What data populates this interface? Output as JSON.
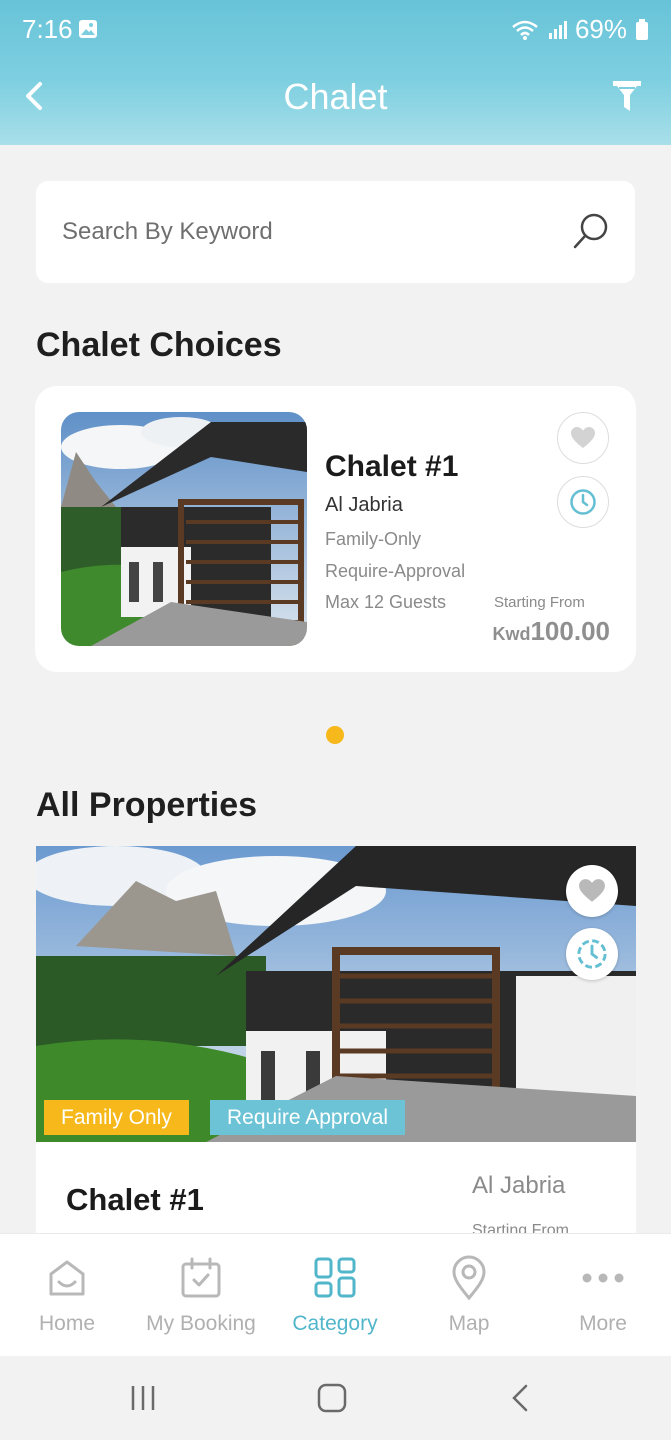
{
  "status": {
    "time": "7:16",
    "battery": "69%"
  },
  "header": {
    "title": "Chalet"
  },
  "search": {
    "placeholder": "Search By Keyword"
  },
  "sections": {
    "choices_title": "Chalet Choices",
    "all_title": "All Properties"
  },
  "choice_card": {
    "name": "Chalet #1",
    "location": "Al Jabria",
    "tags": [
      "Family-Only",
      "Require-Approval",
      "Max 12 Guests"
    ],
    "starting_label": "Starting From",
    "currency": "Kwd",
    "price": "100.00"
  },
  "property_card": {
    "badges": [
      "Family Only",
      "Require Approval"
    ],
    "name": "Chalet #1",
    "location": "Al Jabria",
    "starting_label": "Starting From"
  },
  "tabs": [
    {
      "label": "Home",
      "icon": "home-icon"
    },
    {
      "label": "My Booking",
      "icon": "calendar-icon"
    },
    {
      "label": "Category",
      "icon": "category-icon",
      "active": true
    },
    {
      "label": "Map",
      "icon": "map-pin-icon"
    },
    {
      "label": "More",
      "icon": "more-icon"
    }
  ],
  "colors": {
    "accent": "#52b6cb",
    "yellow": "#f6b81b",
    "header": "#6cc3d5"
  }
}
